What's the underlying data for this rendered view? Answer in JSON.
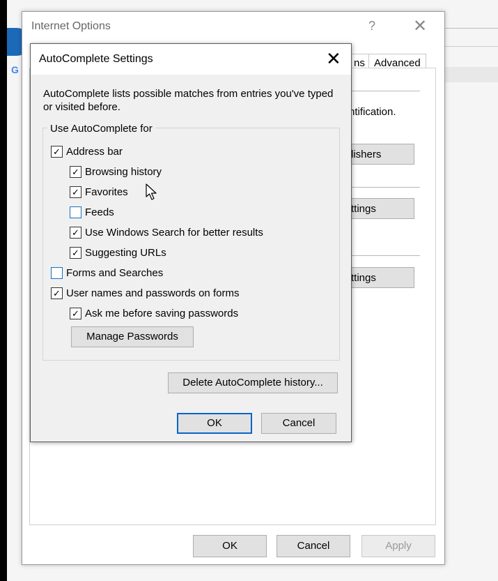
{
  "background": {
    "g_letter": "G"
  },
  "internet_options": {
    "title": "Internet Options",
    "help_glyph": "?",
    "close_glyph": "✕",
    "tabs": {
      "connections_partial": "ns",
      "advanced": "Advanced"
    },
    "content": {
      "certificate_text_partial": "ntification.",
      "publishers_btn_partial": "lishers",
      "settings_btn1_partial": "ttings",
      "settings_btn2_partial": "ttings"
    },
    "buttons": {
      "ok": "OK",
      "cancel": "Cancel",
      "apply": "Apply"
    }
  },
  "autocomplete": {
    "title": "AutoComplete Settings",
    "close_glyph": "✕",
    "description": "AutoComplete lists possible matches from entries you've typed or visited before.",
    "group_label": "Use AutoComplete for",
    "options": {
      "address_bar": {
        "label": "Address bar",
        "checked": true
      },
      "browsing_history": {
        "label": "Browsing history",
        "checked": true
      },
      "favorites": {
        "label": "Favorites",
        "checked": true
      },
      "feeds": {
        "label": "Feeds",
        "checked": false
      },
      "windows_search": {
        "label": "Use Windows Search for better results",
        "checked": true
      },
      "suggesting_urls": {
        "label": "Suggesting URLs",
        "checked": true
      },
      "forms_searches": {
        "label": "Forms and Searches",
        "checked": false
      },
      "user_names_passwords": {
        "label": "User names and passwords on forms",
        "checked": true
      },
      "ask_before_saving": {
        "label": "Ask me before saving passwords",
        "checked": true
      }
    },
    "check_glyph": "✓",
    "manage_passwords": "Manage Passwords",
    "delete_history": "Delete AutoComplete history...",
    "ok": "OK",
    "cancel": "Cancel"
  },
  "colors": {
    "accent": "#0a64c8",
    "dialog_bg": "#f0f0f0",
    "button_bg": "#e1e1e1"
  }
}
